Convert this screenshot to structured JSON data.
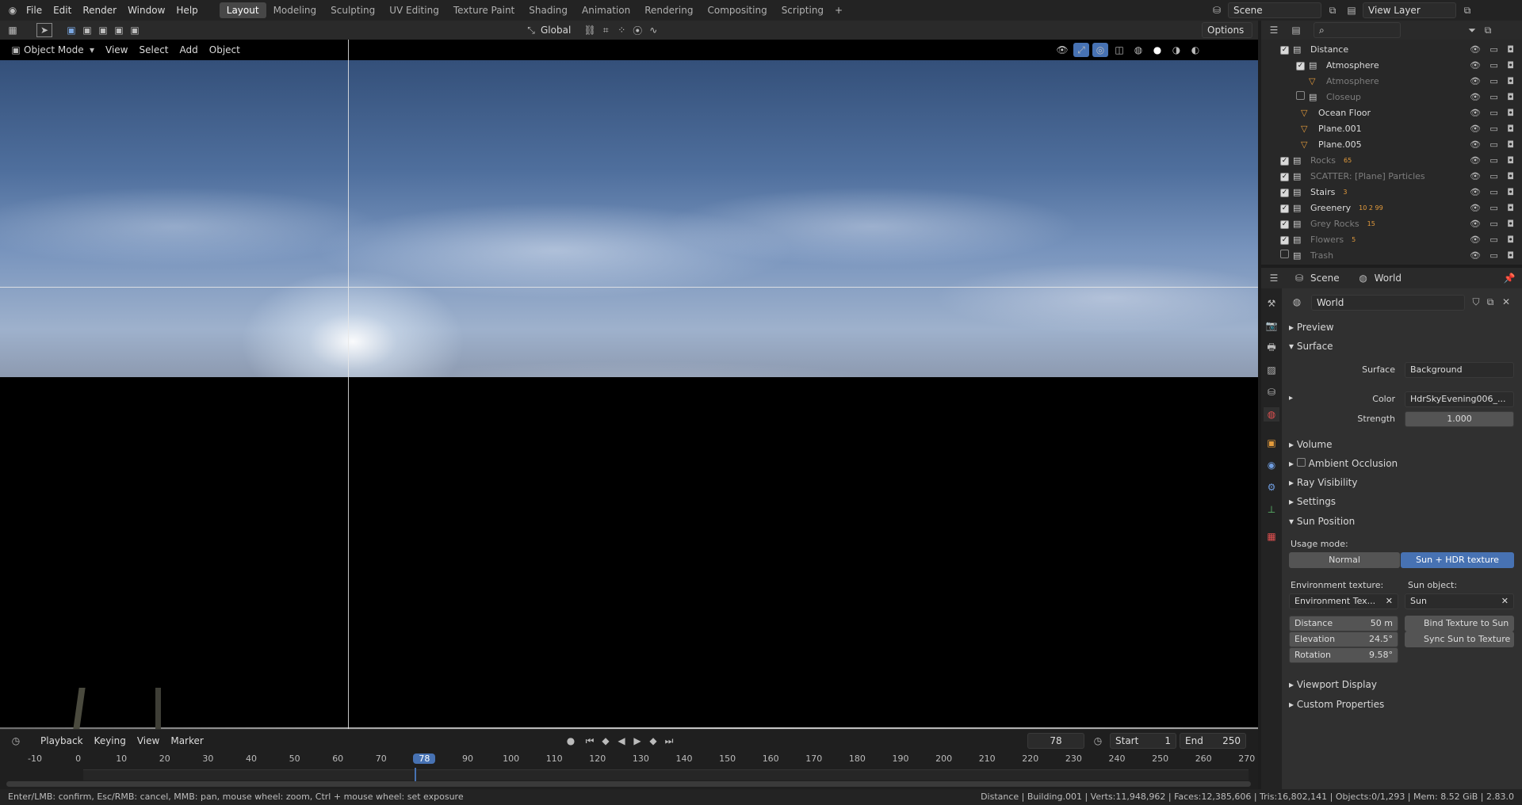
{
  "menu": [
    "File",
    "Edit",
    "Render",
    "Window",
    "Help"
  ],
  "workspaces": [
    "Layout",
    "Modeling",
    "Sculpting",
    "UV Editing",
    "Texture Paint",
    "Shading",
    "Animation",
    "Rendering",
    "Compositing",
    "Scripting"
  ],
  "scene": "Scene",
  "view_layer": "View Layer",
  "viewport_header": {
    "mode": "Object Mode",
    "menus": [
      "View",
      "Select",
      "Add",
      "Object"
    ],
    "transform_orientation": "Global",
    "options": "Options"
  },
  "outliner": {
    "rows": [
      {
        "label": "Distance",
        "checked": true,
        "dim": false
      },
      {
        "label": "Atmosphere",
        "checked": true,
        "dim": false
      },
      {
        "label": "Atmosphere",
        "checked": null,
        "dim": true
      },
      {
        "label": "Closeup",
        "checked": false,
        "dim": true
      },
      {
        "label": "Ocean Floor",
        "checked": null,
        "dim": false
      },
      {
        "label": "Plane.001",
        "checked": null,
        "dim": false
      },
      {
        "label": "Plane.005",
        "checked": null,
        "dim": false
      },
      {
        "label": "Rocks",
        "checked": true,
        "dim": true,
        "badge": "65"
      },
      {
        "label": "SCATTER: [Plane] Particles",
        "checked": true,
        "dim": true
      },
      {
        "label": "Stairs",
        "checked": true,
        "dim": false,
        "badge": "3"
      },
      {
        "label": "Greenery",
        "checked": true,
        "dim": false,
        "badge": "10 2 99"
      },
      {
        "label": "Grey Rocks",
        "checked": true,
        "dim": true,
        "badge": "15"
      },
      {
        "label": "Flowers",
        "checked": true,
        "dim": true,
        "badge": "5"
      },
      {
        "label": "Trash",
        "checked": false,
        "dim": true
      }
    ]
  },
  "properties": {
    "breadcrumb_scene": "Scene",
    "breadcrumb_world": "World",
    "world_name": "World",
    "preview": "Preview",
    "surface": "Surface",
    "surface_label": "Surface",
    "surface_value": "Background",
    "color_label": "Color",
    "color_value": "HdrSkyEvening006_...",
    "strength_label": "Strength",
    "strength_value": "1.000",
    "volume": "Volume",
    "ambient_occlusion": "Ambient Occlusion",
    "ray_visibility": "Ray Visibility",
    "settings": "Settings",
    "sun_position": "Sun Position",
    "usage_mode": "Usage mode:",
    "mode_normal": "Normal",
    "mode_hdr": "Sun + HDR texture",
    "env_texture_label": "Environment texture:",
    "env_texture_value": "Environment Tex...",
    "sun_object_label": "Sun object:",
    "sun_object_value": "Sun",
    "distance_label": "Distance",
    "distance_value": "50 m",
    "elevation_label": "Elevation",
    "elevation_value": "24.5°",
    "rotation_label": "Rotation",
    "rotation_value": "9.58°",
    "bind_texture": "Bind Texture to Sun",
    "sync_sun": "Sync Sun to Texture",
    "viewport_display": "Viewport Display",
    "custom_properties": "Custom Properties"
  },
  "timeline": {
    "menus": [
      "Playback",
      "Keying",
      "View",
      "Marker"
    ],
    "current_frame": "78",
    "start_label": "Start",
    "start": "1",
    "end_label": "End",
    "end": "250",
    "ticks": [
      "-10",
      "0",
      "10",
      "20",
      "30",
      "40",
      "50",
      "60",
      "70",
      "78",
      "90",
      "100",
      "110",
      "120",
      "130",
      "140",
      "150",
      "160",
      "170",
      "180",
      "190",
      "200",
      "210",
      "220",
      "230",
      "240",
      "250",
      "260",
      "270"
    ]
  },
  "status": {
    "left": "Enter/LMB: confirm, Esc/RMB: cancel, MMB: pan, mouse wheel: zoom, Ctrl + mouse wheel: set exposure",
    "right": "Distance | Building.001 | Verts:11,948,962 | Faces:12,385,606 | Tris:16,802,141 | Objects:0/1,293 | Mem: 8.52 GiB | 2.83.0"
  },
  "colors": {
    "accent": "#4772b3",
    "selected_frame": "#4772b3"
  }
}
